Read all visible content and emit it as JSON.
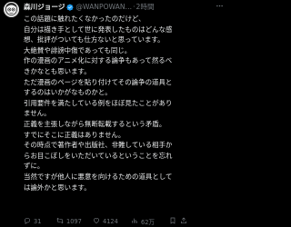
{
  "author": {
    "name": "森川ジョージ",
    "handle": "@WANPOWAN…",
    "separator": "·",
    "time": "2時間",
    "verified_color": "#1d9bf0"
  },
  "more_icon": "more-horizontal-icon",
  "tweet": {
    "lines": [
      "この話題に触れたくなかったのだけど、",
      "自分は描き手として世に発表したものはどんな感",
      "想、批評がついても仕方ないと思っています。",
      "大絶賛や誹謗中傷であっても同じ。",
      "作の漫画のアニメ化に対する論争もあって然るべ",
      "きかなとも思います。",
      "ただ漫画のページを貼り付けてその論争の道具と",
      "するのはいかがなものかと。",
      "引用要件を満たしている例をほぼ見たことがあり",
      "ません。",
      "正義を主張しながら無断転載するという矛盾。",
      "すでにそこに正義はありません。",
      "その時点で著作者や出版社、非難している相手か",
      "らお目こぼしをいただいているということを忘れ",
      "ずに。",
      "当然ですが他人に悪意を向けるための道具として",
      "は論外かと思います。"
    ]
  },
  "actions": {
    "replies": "31",
    "retweets": "1097",
    "likes": "4124",
    "views": "62万"
  }
}
